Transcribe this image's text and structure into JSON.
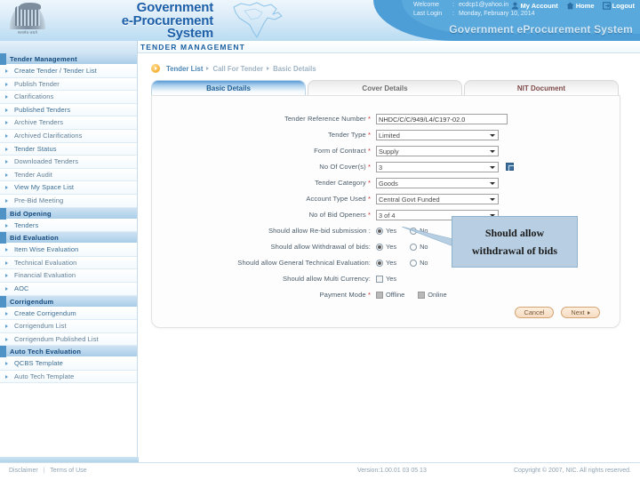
{
  "header": {
    "brand_lines": [
      "Government",
      "e-Procurement",
      "System"
    ],
    "emblem_caption": "सत्यमेव जयते",
    "welcome_label": "Welcome",
    "welcome_sep": ":",
    "welcome_value": "ecdcp1@yahoo.in",
    "lastlogin_label": "Last Login",
    "lastlogin_sep": ":",
    "lastlogin_value": "Monday, February 10, 2014",
    "nav": [
      {
        "label": "My Account",
        "icon": "user-icon"
      },
      {
        "label": "Home",
        "icon": "home-icon"
      },
      {
        "label": "Logout",
        "icon": "logout-icon"
      }
    ],
    "gov_title": "Government eProcurement System"
  },
  "module_title": "TENDER MANAGEMENT",
  "sidebar": {
    "groups": [
      {
        "title": "Tender Management",
        "items": [
          "Create Tender / Tender List",
          "Publish Tender",
          "Clarifications",
          "Published Tenders",
          "Archive Tenders",
          "Archived Clarifications",
          "Tender Status",
          "Downloaded Tenders",
          "Tender Audit",
          "View My Space List",
          "Pre-Bid Meeting"
        ]
      },
      {
        "title": "Bid Opening",
        "items": [
          "Tenders"
        ]
      },
      {
        "title": "Bid Evaluation",
        "items": [
          "Item Wise Evaluation",
          "Technical Evaluation",
          "Financial Evaluation",
          "AOC"
        ]
      },
      {
        "title": "Corrigendum",
        "items": [
          "Create Corrigendum",
          "Corrigendum List",
          "Corrigendum Published List"
        ]
      },
      {
        "title": "Auto Tech Evaluation",
        "items": [
          "QCBS Template",
          "Auto Tech Template"
        ]
      }
    ]
  },
  "breadcrumb": {
    "items": [
      "Tender List",
      "Call For Tender",
      "Basic Details"
    ]
  },
  "tabs": [
    {
      "label": "Basic Details",
      "active": true
    },
    {
      "label": "Cover Details",
      "active": false
    },
    {
      "label": "NIT Document",
      "active": false
    }
  ],
  "form": {
    "fields": [
      {
        "label": "Tender Reference Number",
        "required": true,
        "type": "text",
        "value": "NHDC/C/C/949/L4/C197-02.0"
      },
      {
        "label": "Tender Type",
        "required": true,
        "type": "select",
        "value": "Limited"
      },
      {
        "label": "Form of Contract",
        "required": true,
        "type": "select",
        "value": "Supply"
      },
      {
        "label": "No Of Cover(s)",
        "required": true,
        "type": "select",
        "value": "3",
        "help": true
      },
      {
        "label": "Tender Category",
        "required": true,
        "type": "select",
        "value": "Goods"
      },
      {
        "label": "Account Type Used",
        "required": true,
        "type": "select",
        "value": "Central Govt Funded"
      },
      {
        "label": "No of Bid Openers",
        "required": true,
        "type": "select",
        "value": "3 of 4"
      },
      {
        "label": "Should allow Re-bid submission :",
        "required": false,
        "type": "radio",
        "options": [
          "Yes",
          "No"
        ],
        "selected": "Yes"
      },
      {
        "label": "Should allow Withdrawal of bids:",
        "required": false,
        "type": "radio",
        "options": [
          "Yes",
          "No"
        ],
        "selected": "Yes"
      },
      {
        "label": "Should allow General Technical Evaluation:",
        "required": false,
        "type": "radio",
        "options": [
          "Yes",
          "No"
        ],
        "selected": "Yes"
      },
      {
        "label": "Should allow Multi Currency:",
        "required": false,
        "type": "checkbox",
        "options": [
          "Yes"
        ],
        "checked": false
      },
      {
        "label": "Payment Mode",
        "required": true,
        "type": "checkbox2",
        "options": [
          "Offline",
          "Online"
        ],
        "checked": "Offline"
      }
    ],
    "buttons": {
      "cancel": "Cancel",
      "next": "Next"
    }
  },
  "callout": {
    "line1": "Should allow",
    "line2": "withdrawal of bids"
  },
  "footer": {
    "disclaimer": "Disclaimer",
    "terms": "Terms of Use",
    "divider": "|",
    "version": "Version:1.00.01 03 05 13",
    "copyright": "Copyright © 2007, NIC. All rights reserved."
  }
}
